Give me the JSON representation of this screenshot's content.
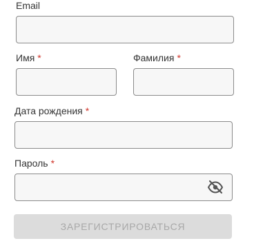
{
  "form": {
    "email": {
      "label": "Email",
      "value": "",
      "placeholder": ""
    },
    "first_name": {
      "label": "Имя",
      "required_mark": "*",
      "value": "",
      "placeholder": ""
    },
    "last_name": {
      "label": "Фамилия",
      "required_mark": "*",
      "value": "",
      "placeholder": ""
    },
    "birth_date": {
      "label": "Дата рождения",
      "required_mark": "*",
      "value": "",
      "placeholder": ""
    },
    "password": {
      "label": "Пароль",
      "required_mark": "*",
      "value": "",
      "placeholder": "",
      "visibility_icon": "eye-off-icon"
    },
    "submit_label": "ЗАРЕГИСТРИРОВАТЬСЯ",
    "submit_enabled": false
  },
  "colors": {
    "required": "#d0362b",
    "field_border": "#8a8a8a",
    "field_bg": "#f7f7f7",
    "button_bg_disabled": "#dcdcdc",
    "button_text_disabled": "#a8a8a8",
    "icon": "#555555"
  }
}
